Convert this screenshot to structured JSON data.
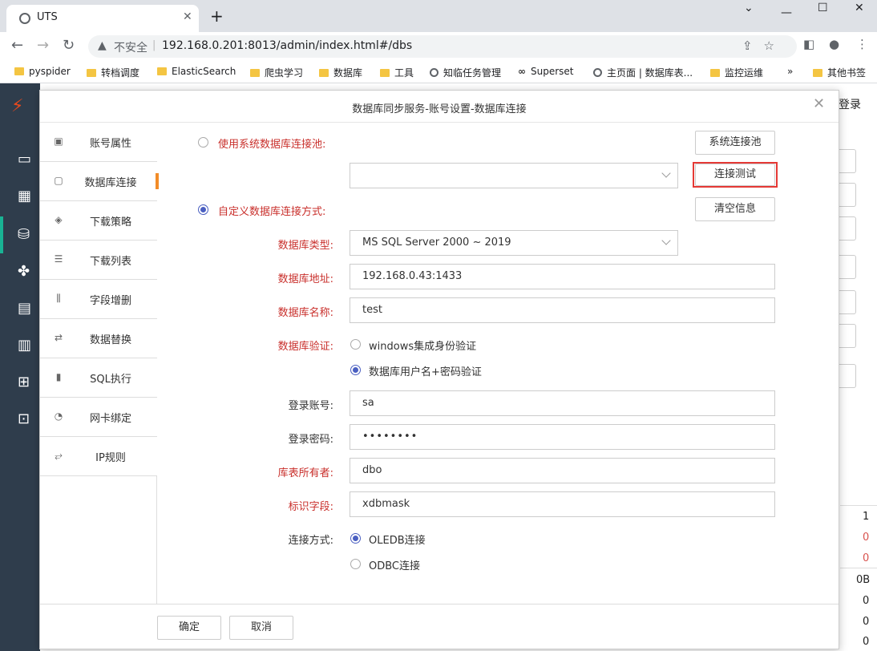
{
  "browser": {
    "tab_title": "UTS",
    "insecure_label": "不安全",
    "url": "192.168.0.201:8013/admin/index.html#/dbs",
    "bookmarks": [
      {
        "label": "pyspider",
        "icon": "folder"
      },
      {
        "label": "转档调度",
        "icon": "folder"
      },
      {
        "label": "ElasticSearch",
        "icon": "folder"
      },
      {
        "label": "爬虫学习",
        "icon": "folder"
      },
      {
        "label": "数据库",
        "icon": "folder"
      },
      {
        "label": "工具",
        "icon": "folder"
      },
      {
        "label": "知临任务管理",
        "icon": "globe"
      },
      {
        "label": "Superset",
        "icon": "infinity"
      },
      {
        "label": "主页面 | 数据库表...",
        "icon": "globe"
      },
      {
        "label": "监控运维",
        "icon": "folder"
      },
      {
        "label": "»",
        "icon": "none"
      },
      {
        "label": "其他书签",
        "icon": "folder"
      }
    ]
  },
  "background": {
    "login_label": "登录",
    "numbers": [
      "1",
      "0",
      "0",
      "0B",
      "0",
      "0",
      "0"
    ],
    "number_colors": [
      "#222222",
      "#d9534f",
      "#d9534f",
      "#222222",
      "#222222",
      "#222222",
      "#222222"
    ]
  },
  "dialog": {
    "title": "数据库同步服务-账号设置-数据库连接",
    "nav": [
      {
        "label": "账号属性",
        "icon": "account-card-icon"
      },
      {
        "label": "数据库连接",
        "icon": "db-monitor-icon",
        "active": true
      },
      {
        "label": "下载策略",
        "icon": "strategy-diamond-icon"
      },
      {
        "label": "下载列表",
        "icon": "list-icon"
      },
      {
        "label": "字段增删",
        "icon": "columns-icon"
      },
      {
        "label": "数据替换",
        "icon": "replace-icon"
      },
      {
        "label": "SQL执行",
        "icon": "bar-chart-icon"
      },
      {
        "label": "网卡绑定",
        "icon": "pie-chart-icon"
      },
      {
        "label": "IP规则",
        "icon": "route-icon"
      }
    ],
    "form": {
      "use_pool_label": "使用系统数据库连接池:",
      "pool_select_value": "",
      "custom_label": "自定义数据库连接方式:",
      "system_pool_button": "系统连接池",
      "test_button": "连接测试",
      "clear_button": "清空信息",
      "db_type_label": "数据库类型:",
      "db_type_value": "MS SQL Server 2000 ~ 2019",
      "db_address_label": "数据库地址:",
      "db_address_value": "192.168.0.43:1433",
      "db_name_label": "数据库名称:",
      "db_name_value": "test",
      "auth_label": "数据库验证:",
      "auth_windows": "windows集成身份验证",
      "auth_password": "数据库用户名+密码验证",
      "login_account_label": "登录账号:",
      "login_account_value": "sa",
      "login_password_label": "登录密码:",
      "login_password_value": "••••••••",
      "owner_label": "库表所有者:",
      "owner_value": "dbo",
      "mark_field_label": "标识字段:",
      "mark_field_value": "xdbmask",
      "conn_mode_label": "连接方式:",
      "conn_oledb": "OLEDB连接",
      "conn_odbc": "ODBC连接"
    },
    "footer": {
      "ok": "确定",
      "cancel": "取消"
    }
  }
}
